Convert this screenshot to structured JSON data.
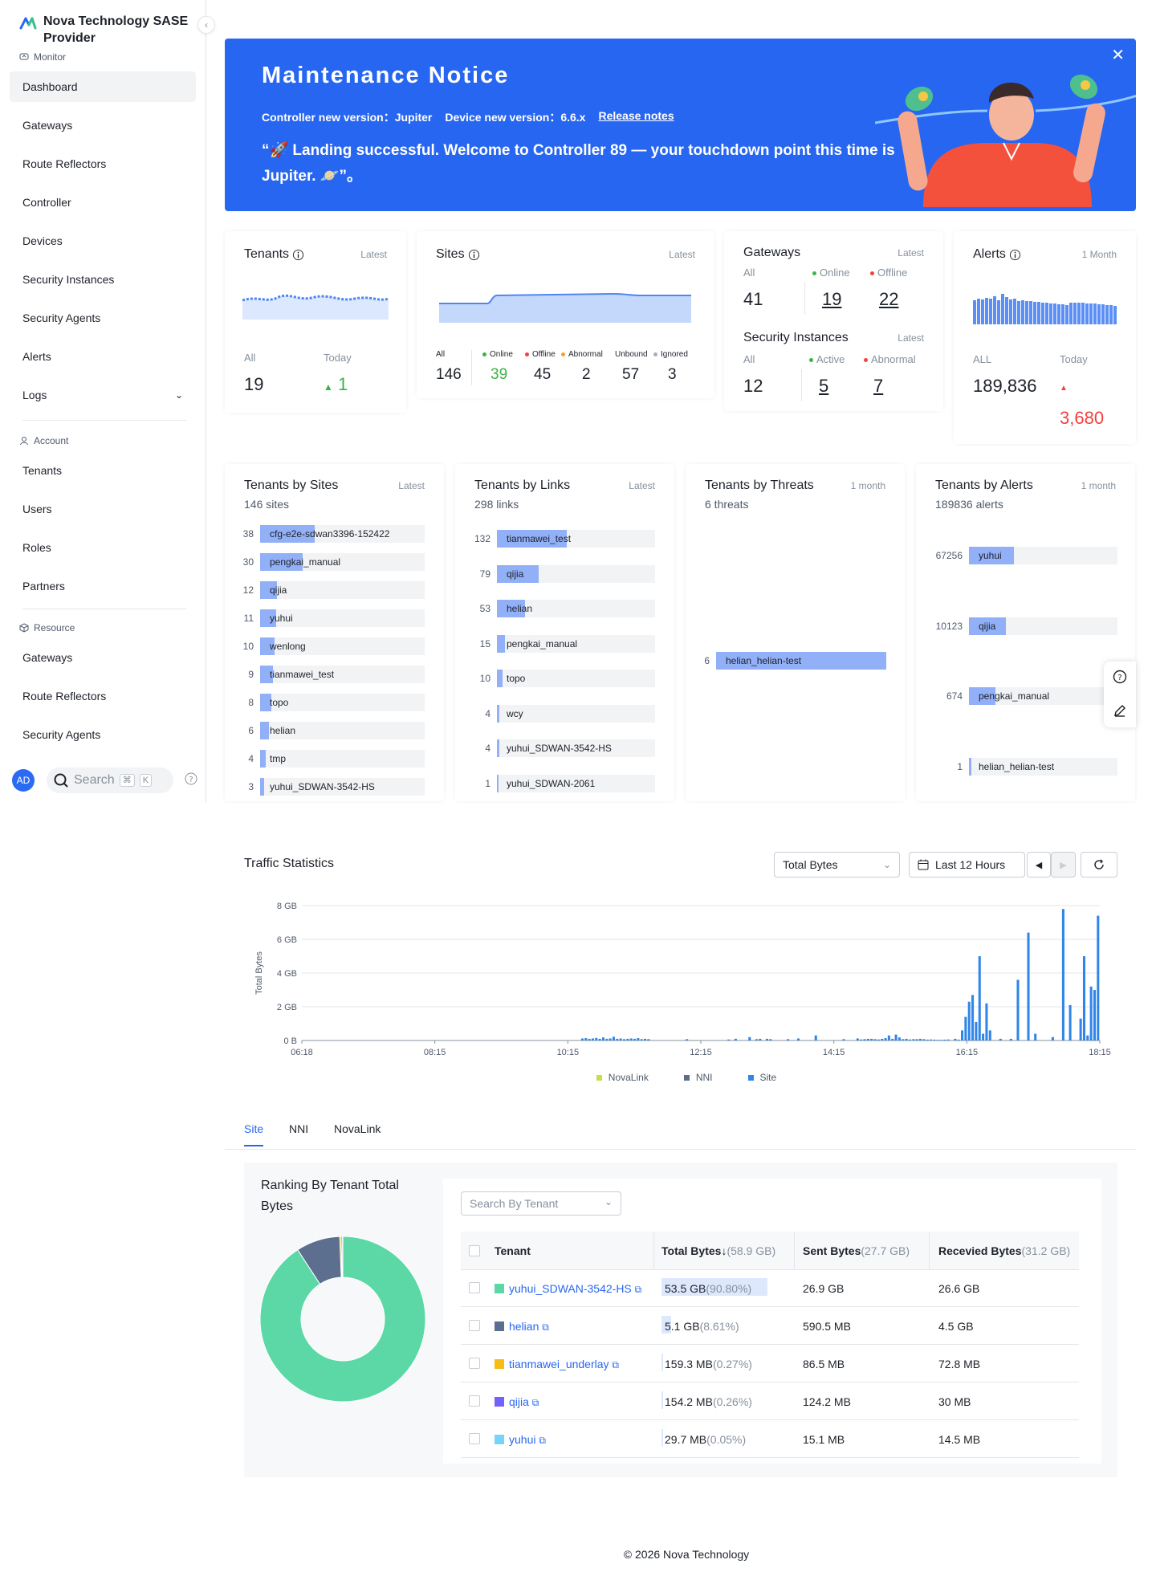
{
  "sidebar": {
    "brand": "Nova Technology SASE Provider",
    "sections": {
      "monitor": "Monitor",
      "account": "Account",
      "resource": "Resource"
    },
    "monitor_items": [
      "Dashboard",
      "Gateways",
      "Route Reflectors",
      "Controller",
      "Devices",
      "Security Instances",
      "Security Agents",
      "Alerts",
      "Logs"
    ],
    "account_items": [
      "Tenants",
      "Users",
      "Roles",
      "Partners"
    ],
    "resource_items": [
      "Gateways",
      "Route Reflectors",
      "Security Agents"
    ],
    "avatar": "AD",
    "search": "Search",
    "kbd1": "⌘",
    "kbd2": "K"
  },
  "banner": {
    "title": "Maintenance Notice",
    "controller_label": "Controller new version：Jupiter",
    "device_label": "Device new version：6.6.x",
    "release_notes": "Release notes",
    "message": "“🚀 Landing successful. Welcome to Controller 89 — your touchdown point this time is Jupiter. 🪐”。"
  },
  "tenants_card": {
    "title": "Tenants",
    "tag": "Latest",
    "all_label": "All",
    "all": "19",
    "today_label": "Today",
    "today": "1"
  },
  "sites_card": {
    "title": "Sites",
    "tag": "Latest",
    "labels": [
      "All",
      "Online",
      "Offline",
      "Abnormal",
      "Unbound",
      "Ignored"
    ],
    "values": [
      "146",
      "39",
      "45",
      "2",
      "57",
      "3"
    ]
  },
  "gateways_card": {
    "title": "Gateways",
    "tag": "Latest",
    "all_label": "All",
    "online_label": "Online",
    "offline_label": "Offline",
    "all": "41",
    "online": "19",
    "offline": "22",
    "sec_title": "Security Instances",
    "sec_tag": "Latest",
    "sec_all_label": "All",
    "sec_active_label": "Active",
    "sec_abnormal_label": "Abnormal",
    "sec_all": "12",
    "sec_active": "5",
    "sec_abnormal": "7"
  },
  "alerts_card": {
    "title": "Alerts",
    "tag": "1 Month",
    "all_label": "ALL",
    "all": "189,836",
    "today_label": "Today",
    "today": "3,680"
  },
  "tenants_by_sites": {
    "title": "Tenants by Sites",
    "tag": "Latest",
    "sub": "146 sites",
    "rows": [
      {
        "v": 38,
        "n": "cfg-e2e-sdwan3396-152422"
      },
      {
        "v": 30,
        "n": "pengkai_manual"
      },
      {
        "v": 12,
        "n": "qijia"
      },
      {
        "v": 11,
        "n": "yuhui"
      },
      {
        "v": 10,
        "n": "wenlong"
      },
      {
        "v": 9,
        "n": "tianmawei_test"
      },
      {
        "v": 8,
        "n": "topo"
      },
      {
        "v": 6,
        "n": "helian"
      },
      {
        "v": 4,
        "n": "tmp"
      },
      {
        "v": 3,
        "n": "yuhui_SDWAN-3542-HS"
      }
    ]
  },
  "tenants_by_links": {
    "title": "Tenants by Links",
    "tag": "Latest",
    "sub": "298 links",
    "rows": [
      {
        "v": 132,
        "n": "tianmawei_test"
      },
      {
        "v": 79,
        "n": "qijia"
      },
      {
        "v": 53,
        "n": "helian"
      },
      {
        "v": 15,
        "n": "pengkai_manual"
      },
      {
        "v": 10,
        "n": "topo"
      },
      {
        "v": 4,
        "n": "wcy"
      },
      {
        "v": 4,
        "n": "yuhui_SDWAN-3542-HS"
      },
      {
        "v": 1,
        "n": "yuhui_SDWAN-2061"
      }
    ]
  },
  "tenants_by_threats": {
    "title": "Tenants by Threats",
    "tag": "1 month",
    "sub": "6 threats",
    "rows": [
      {
        "v": 6,
        "n": "helian_helian-test"
      }
    ]
  },
  "tenants_by_alerts": {
    "title": "Tenants by Alerts",
    "tag": "1 month",
    "sub": "189836 alerts",
    "rows": [
      {
        "v": 67256,
        "n": "yuhui"
      },
      {
        "v": 10123,
        "n": "qijia"
      },
      {
        "v": 674,
        "n": "pengkai_manual"
      },
      {
        "v": 1,
        "n": "helian_helian-test"
      }
    ]
  },
  "traffic": {
    "title": "Traffic Statistics",
    "metric": "Total Bytes",
    "range": "Last 12 Hours",
    "legend": [
      {
        "name": "NovaLink",
        "color": "#c6e04a"
      },
      {
        "name": "NNI",
        "color": "#5b6e8c"
      },
      {
        "name": "Site",
        "color": "#2f86e8"
      }
    ]
  },
  "chart_data": {
    "type": "bar",
    "ylabel": "Total Bytes",
    "ylim": [
      0,
      8
    ],
    "yticks": [
      "0 B",
      "2 GB",
      "4 GB",
      "6 GB",
      "8 GB"
    ],
    "xticks": [
      "06:18",
      "08:15",
      "10:15",
      "12:15",
      "14:15",
      "16:15",
      "18:15"
    ],
    "series": [
      {
        "name": "Site",
        "unit": "GB",
        "values": [
          0,
          0,
          0,
          0,
          0,
          0,
          0,
          0,
          0,
          0,
          0,
          0,
          0,
          0,
          0,
          0,
          0,
          0,
          0,
          0,
          0,
          0,
          0,
          0,
          0,
          0,
          0,
          0,
          0,
          0,
          0,
          0,
          0,
          0,
          0,
          0,
          0,
          0,
          0,
          0,
          0,
          0,
          0,
          0,
          0,
          0,
          0,
          0,
          0,
          0,
          0,
          0,
          0,
          0,
          0,
          0,
          0,
          0,
          0,
          0,
          0,
          0,
          0,
          0,
          0,
          0,
          0,
          0,
          0,
          0,
          0,
          0,
          0,
          0,
          0,
          0,
          0,
          0,
          0,
          0,
          0.12,
          0.14,
          0.1,
          0.12,
          0.15,
          0.1,
          0.18,
          0.1,
          0.12,
          0.22,
          0.1,
          0.12,
          0.08,
          0.1,
          0.12,
          0.1,
          0.14,
          0.08,
          0.1,
          0.08,
          0,
          0,
          0,
          0,
          0,
          0,
          0,
          0,
          0,
          0,
          0.08,
          0,
          0,
          0,
          0,
          0,
          0,
          0,
          0,
          0,
          0,
          0,
          0.06,
          0,
          0.1,
          0,
          0,
          0,
          0.2,
          0,
          0.08,
          0.1,
          0,
          0.1,
          0.08,
          0,
          0,
          0,
          0,
          0.08,
          0,
          0,
          0.12,
          0,
          0,
          0,
          0,
          0.3,
          0,
          0,
          0,
          0,
          0,
          0,
          0,
          0.08,
          0,
          0,
          0,
          0.12,
          0.06,
          0.08,
          0.1,
          0.1,
          0.08,
          0.06,
          0.1,
          0.14,
          0.3,
          0.1,
          0.35,
          0.18,
          0.08,
          0.1,
          0.06,
          0.08,
          0.08,
          0.1,
          0.08,
          0.05,
          0.06,
          0.05,
          0.04,
          0.04,
          0.05,
          0.06,
          0,
          0.1,
          0.05,
          0.6,
          1.4,
          2.3,
          2.7,
          1.1,
          5.0,
          0.4,
          2.2,
          0.6,
          0,
          0,
          0.1,
          0,
          0,
          0.1,
          0,
          3.6,
          0,
          0,
          6.4,
          0,
          0.4,
          0,
          0,
          0,
          0,
          0.2,
          0,
          0,
          7.8,
          0,
          2.1,
          0,
          0,
          1.3,
          5.0,
          0.3,
          3.2,
          3.0,
          7.4
        ]
      },
      {
        "name": "NNI",
        "unit": "GB",
        "values": []
      },
      {
        "name": "NovaLink",
        "unit": "GB",
        "values": []
      }
    ]
  },
  "tabs": [
    "Site",
    "NNI",
    "NovaLink"
  ],
  "ranking": {
    "title": "Ranking By Tenant Total Bytes",
    "search_placeholder": "Search By Tenant",
    "headers": {
      "tenant": "Tenant",
      "total": "Total Bytes",
      "total_sum": "(58.9 GB)",
      "sent": "Sent Bytes",
      "sent_sum": "(27.7 GB)",
      "received": "Recevied Bytes",
      "received_sum": "(31.2 GB)"
    },
    "rows": [
      {
        "tenant": "yuhui_SDWAN-3542-HS",
        "color": "#5cd8a6",
        "total": "53.5 GB",
        "pct": "(90.80%)",
        "pct_value": 90.8,
        "sent": "26.9 GB",
        "received": "26.6 GB"
      },
      {
        "tenant": "helian",
        "color": "#5d6f8f",
        "total": "5.1 GB",
        "pct": "(8.61%)",
        "pct_value": 8.61,
        "sent": "590.5 MB",
        "received": "4.5 GB"
      },
      {
        "tenant": "tianmawei_underlay",
        "color": "#f6bd16",
        "total": "159.3 MB",
        "pct": "(0.27%)",
        "pct_value": 0.27,
        "sent": "86.5 MB",
        "received": "72.8 MB"
      },
      {
        "tenant": "qijia",
        "color": "#7262fd",
        "total": "154.2 MB",
        "pct": "(0.26%)",
        "pct_value": 0.26,
        "sent": "124.2 MB",
        "received": "30 MB"
      },
      {
        "tenant": "yuhui",
        "color": "#78d3f8",
        "total": "29.7 MB",
        "pct": "(0.05%)",
        "pct_value": 0.05,
        "sent": "15.1 MB",
        "received": "14.5 MB"
      }
    ]
  },
  "footer": "© 2026 Nova Technology"
}
